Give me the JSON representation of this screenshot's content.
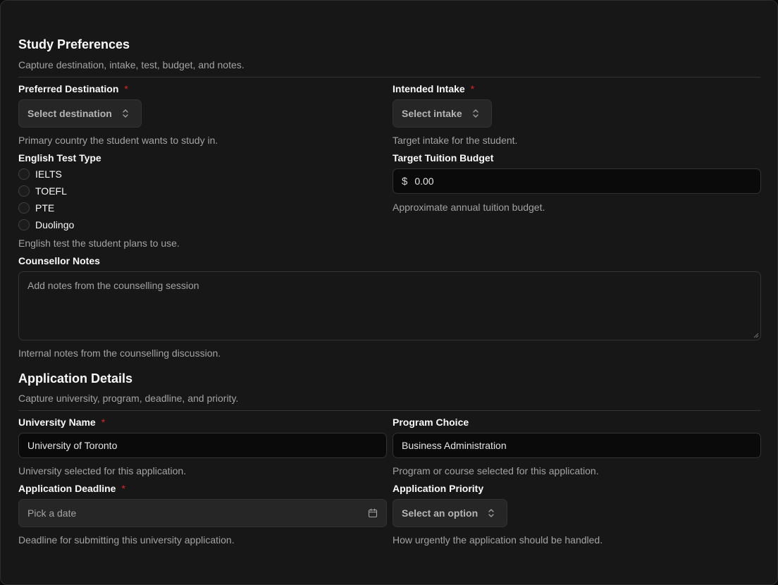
{
  "study": {
    "title": "Study Preferences",
    "description": "Capture destination, intake, test, budget, and notes.",
    "destination": {
      "label": "Preferred Destination",
      "required": "*",
      "placeholder": "Select destination",
      "help": "Primary country the student wants to study in."
    },
    "intake": {
      "label": "Intended Intake",
      "required": "*",
      "placeholder": "Select intake",
      "help": "Target intake for the student."
    },
    "english_test": {
      "label": "English Test Type",
      "options": [
        "IELTS",
        "TOEFL",
        "PTE",
        "Duolingo"
      ],
      "help": "English test the student plans to use."
    },
    "budget": {
      "label": "Target Tuition Budget",
      "currency": "$",
      "value": "0.00",
      "help": "Approximate annual tuition budget."
    },
    "notes": {
      "label": "Counsellor Notes",
      "placeholder": "Add notes from the counselling session",
      "help": "Internal notes from the counselling discussion."
    }
  },
  "application": {
    "title": "Application Details",
    "description": "Capture university, program, deadline, and priority.",
    "university": {
      "label": "University Name",
      "required": "*",
      "value": "University of Toronto",
      "help": "University selected for this application."
    },
    "program": {
      "label": "Program Choice",
      "value": "Business Administration",
      "help": "Program or course selected for this application."
    },
    "deadline": {
      "label": "Application Deadline",
      "required": "*",
      "placeholder": "Pick a date",
      "help": "Deadline for submitting this university application."
    },
    "priority": {
      "label": "Application Priority",
      "placeholder": "Select an option",
      "help": "How urgently the application should be handled."
    }
  },
  "icons": {
    "select": "chevron-up-down-icon",
    "date": "calendar-icon"
  }
}
